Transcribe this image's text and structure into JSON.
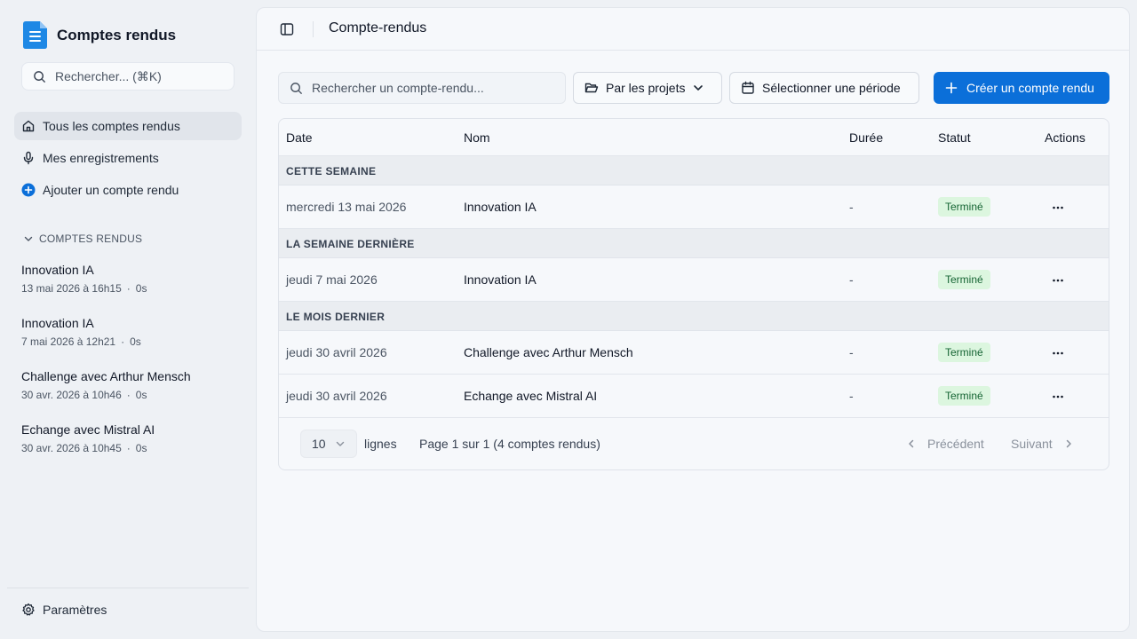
{
  "sidebar": {
    "app_title": "Comptes rendus",
    "search_placeholder": "Rechercher... (⌘K)",
    "nav": [
      {
        "label": "Tous les comptes rendus",
        "icon": "home-icon",
        "active": true
      },
      {
        "label": "Mes enregistrements",
        "icon": "microphone-icon",
        "active": false
      },
      {
        "label": "Ajouter un compte rendu",
        "icon": "plus-circle-icon",
        "active": false
      }
    ],
    "section_title": "COMPTES RENDUS",
    "recent": [
      {
        "name": "Innovation IA",
        "date": "13 mai 2026 à 16h15",
        "duration": "0s"
      },
      {
        "name": "Innovation IA",
        "date": "7 mai 2026 à 12h21",
        "duration": "0s"
      },
      {
        "name": "Challenge avec Arthur Mensch",
        "date": "30 avr. 2026 à 10h46",
        "duration": "0s"
      },
      {
        "name": "Echange avec Mistral AI",
        "date": "30 avr. 2026 à 10h45",
        "duration": "0s"
      }
    ],
    "settings_label": "Paramètres",
    "meta_separator": "·"
  },
  "header": {
    "title": "Compte-rendus"
  },
  "toolbar": {
    "search_placeholder": "Rechercher un compte-rendu...",
    "projects_label": "Par les projets",
    "period_label": "Sélectionner une période",
    "create_label": "Créer un compte rendu"
  },
  "table": {
    "columns": {
      "date": "Date",
      "name": "Nom",
      "duration": "Durée",
      "status": "Statut",
      "actions": "Actions"
    },
    "groups": [
      {
        "label": "CETTE SEMAINE",
        "rows": [
          {
            "date": "mercredi 13 mai 2026",
            "name": "Innovation IA",
            "duration": "-",
            "status": "Terminé"
          }
        ]
      },
      {
        "label": "LA SEMAINE DERNIÈRE",
        "rows": [
          {
            "date": "jeudi 7 mai 2026",
            "name": "Innovation IA",
            "duration": "-",
            "status": "Terminé"
          }
        ]
      },
      {
        "label": "LE MOIS DERNIER",
        "rows": [
          {
            "date": "jeudi 30 avril 2026",
            "name": "Challenge avec Arthur Mensch",
            "duration": "-",
            "status": "Terminé"
          },
          {
            "date": "jeudi 30 avril 2026",
            "name": "Echange avec Mistral AI",
            "duration": "-",
            "status": "Terminé"
          }
        ]
      }
    ]
  },
  "pagination": {
    "rows_per_page": "10",
    "rows_label": "lignes",
    "page_info": "Page 1 sur 1 (4 comptes rendus)",
    "prev_label": "Précédent",
    "next_label": "Suivant"
  },
  "colors": {
    "accent": "#0b6fd9",
    "badge_bg": "#dcf6df",
    "badge_text": "#166534",
    "logo": "#1e88e5"
  }
}
